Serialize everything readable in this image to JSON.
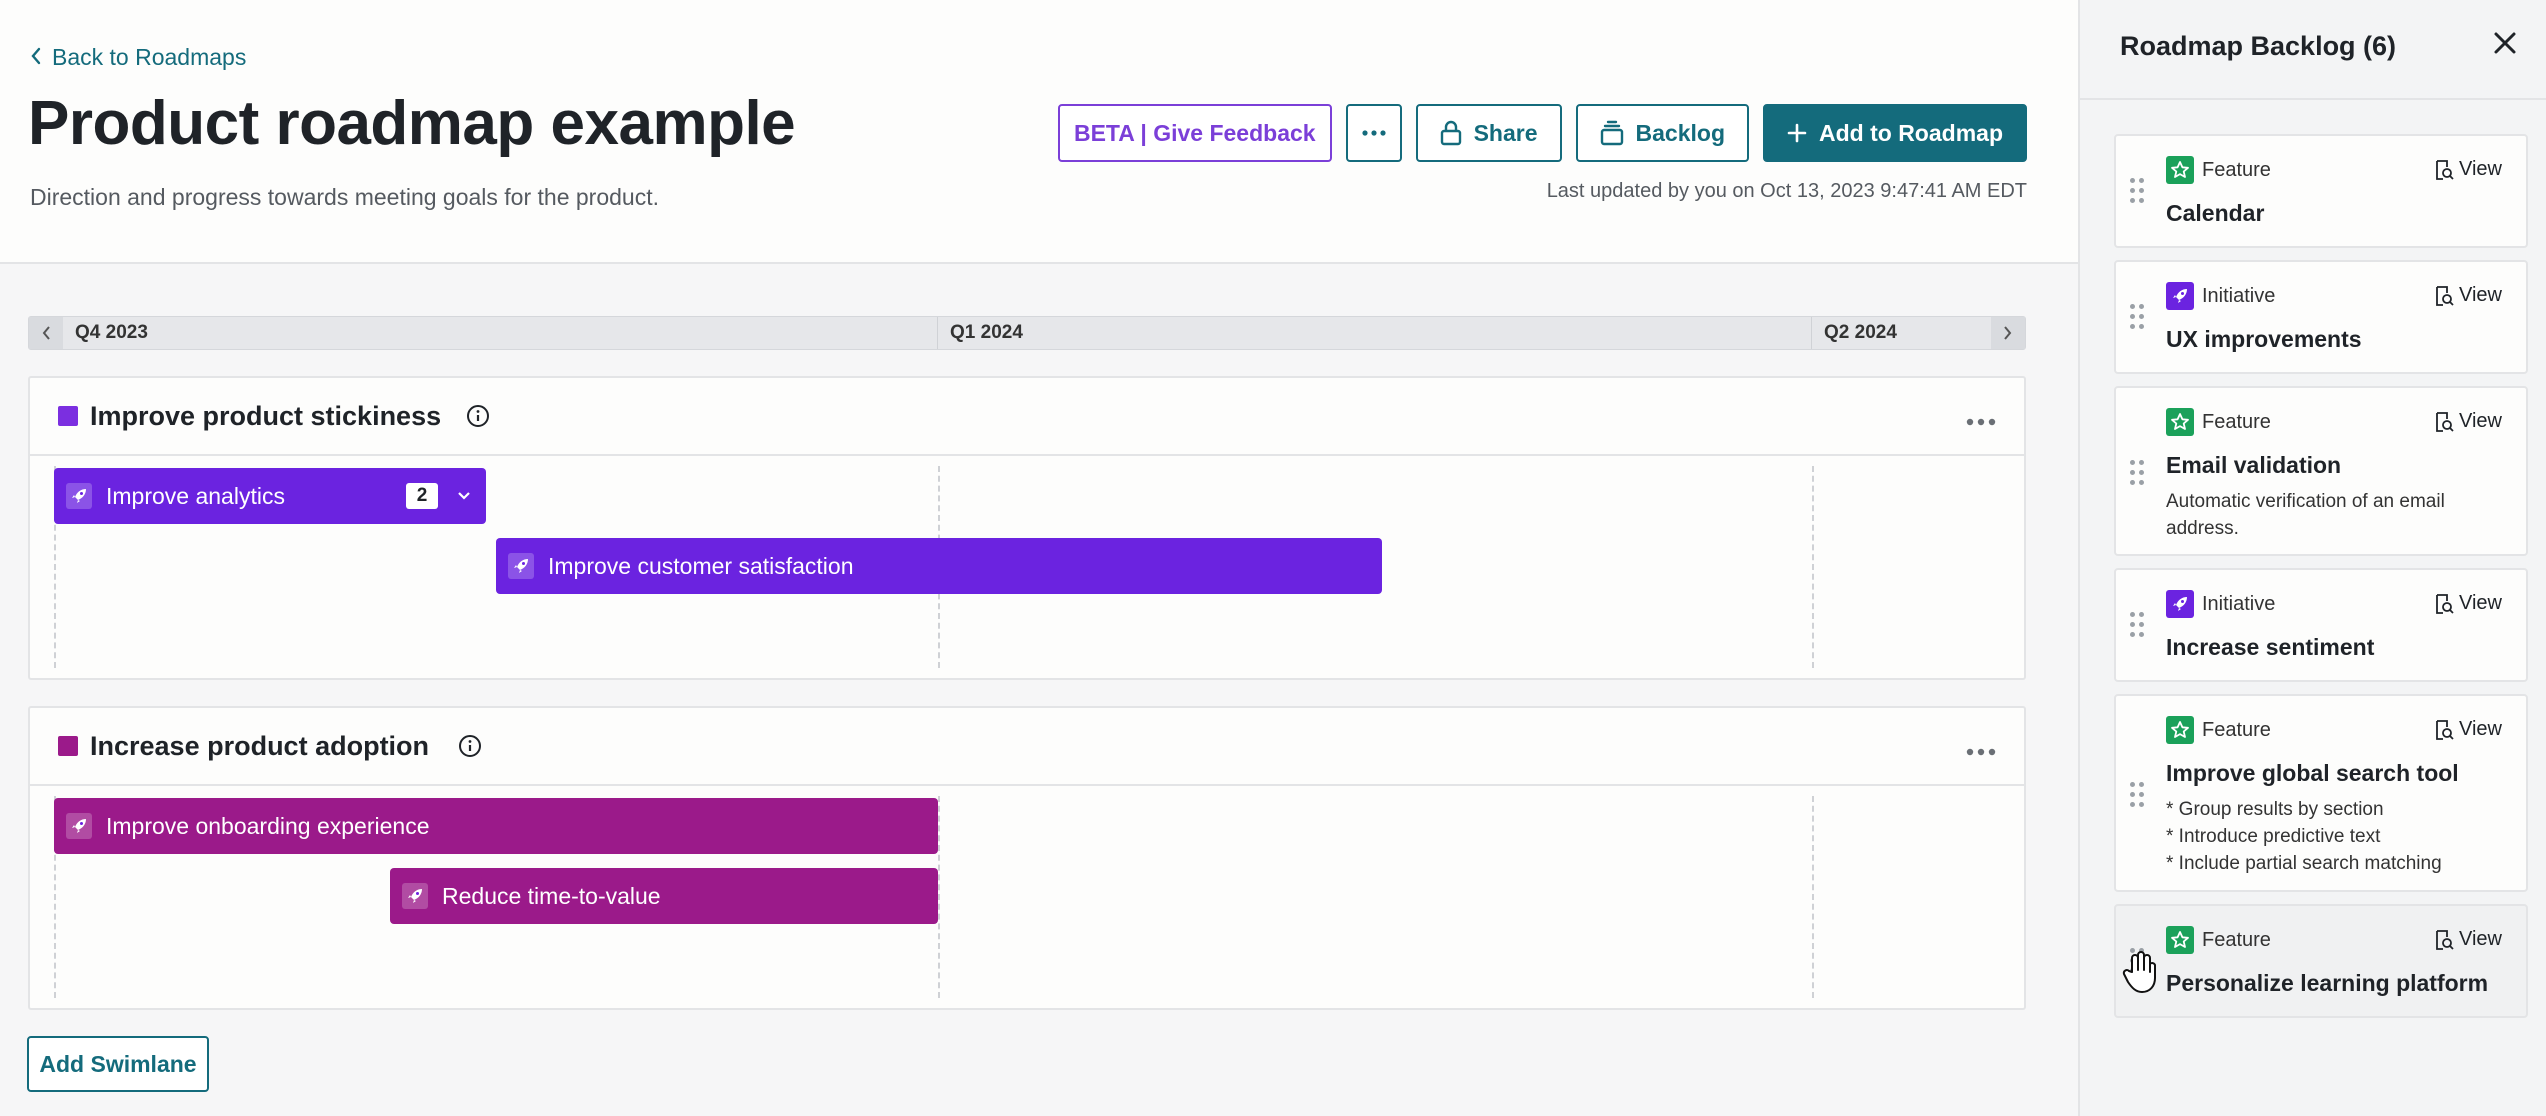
{
  "header": {
    "back_label": "Back to Roadmaps",
    "title": "Product roadmap example",
    "subtitle": "Direction and progress towards meeting goals for the product.",
    "last_updated": "Last updated by you on Oct 13, 2023 9:47:41 AM EDT"
  },
  "toolbar": {
    "beta_label": "BETA | Give Feedback",
    "more_label": "•••",
    "share_label": "Share",
    "backlog_label": "Backlog",
    "add_label": "Add to Roadmap"
  },
  "timeline": {
    "quarters": [
      "Q4 2023",
      "Q1 2024",
      "Q2 2024"
    ]
  },
  "swimlanes": [
    {
      "title": "Improve product stickiness",
      "color": "#7b2fe0",
      "items": [
        {
          "label": "Improve analytics",
          "count": "2"
        },
        {
          "label": "Improve customer satisfaction"
        }
      ]
    },
    {
      "title": "Increase product adoption",
      "color": "#9b1a8a",
      "items": [
        {
          "label": "Improve onboarding experience"
        },
        {
          "label": "Reduce time-to-value"
        }
      ]
    }
  ],
  "add_swimlane_label": "Add Swimlane",
  "backlog": {
    "title": "Roadmap Backlog (6)",
    "view_label": "View",
    "items": [
      {
        "type": "Feature",
        "title": "Calendar",
        "description": ""
      },
      {
        "type": "Initiative",
        "title": "UX improvements",
        "description": ""
      },
      {
        "type": "Feature",
        "title": "Email validation",
        "description": "Automatic verification of an email address."
      },
      {
        "type": "Initiative",
        "title": "Increase sentiment",
        "description": ""
      },
      {
        "type": "Feature",
        "title": "Improve global search tool",
        "description_lines": [
          "* Group results by section",
          "* Introduce predictive text",
          "* Include partial search matching"
        ]
      },
      {
        "type": "Feature",
        "title": "Personalize learning platform",
        "description": ""
      }
    ]
  },
  "colors": {
    "accent": "#146b7c",
    "beta": "#7b3fd8",
    "stickiness_bar": "#6b23e0",
    "adoption_bar": "#9b1a8a",
    "feature_badge": "#1ba15a",
    "initiative_badge": "#6b23e0"
  }
}
